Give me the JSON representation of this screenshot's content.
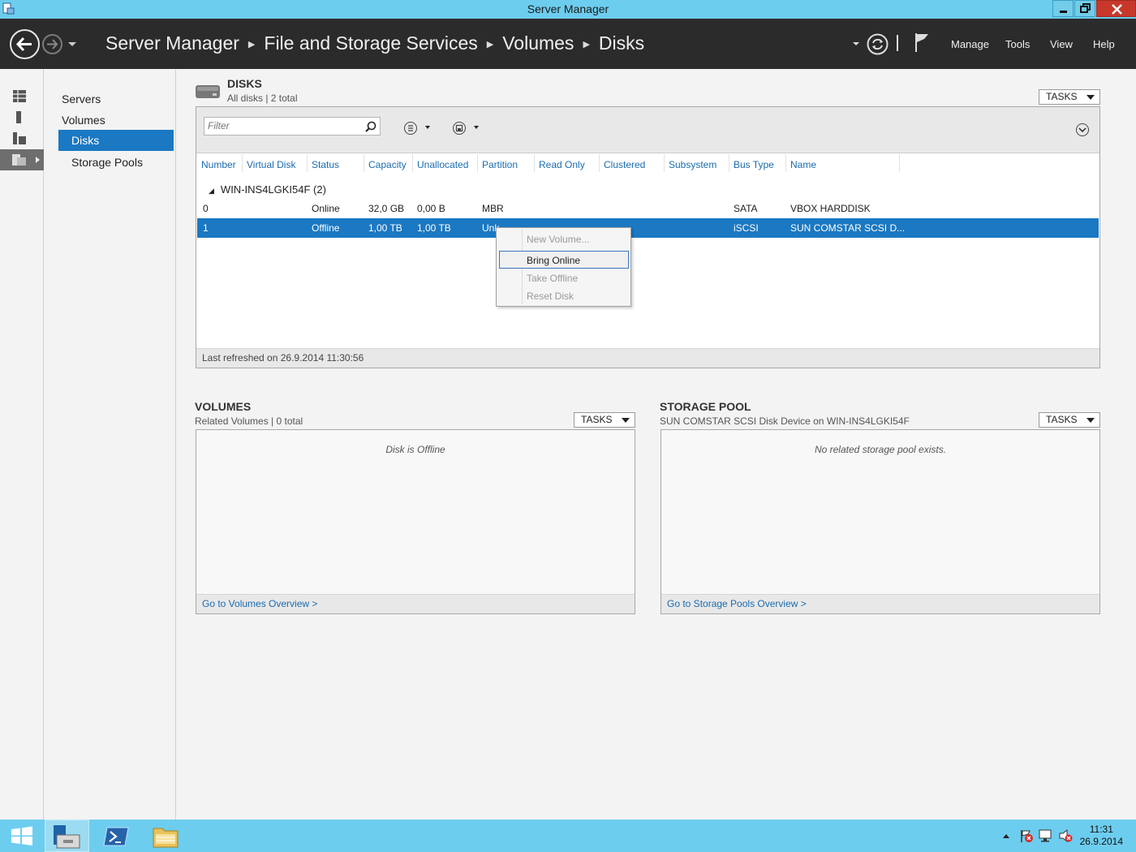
{
  "window": {
    "title": "Server Manager"
  },
  "header": {
    "breadcrumb": [
      "Server Manager",
      "File and Storage Services",
      "Volumes",
      "Disks"
    ],
    "menus": [
      "Manage",
      "Tools",
      "View",
      "Help"
    ]
  },
  "nav": {
    "items": [
      "Servers",
      "Volumes",
      "Disks",
      "Storage Pools"
    ]
  },
  "disks": {
    "title": "DISKS",
    "subtitle": "All disks | 2 total",
    "tasks_label": "TASKS",
    "filter_placeholder": "Filter",
    "columns": [
      "Number",
      "Virtual Disk",
      "Status",
      "Capacity",
      "Unallocated",
      "Partition",
      "Read Only",
      "Clustered",
      "Subsystem",
      "Bus Type",
      "Name"
    ],
    "group": "WIN-INS4LGKI54F (2)",
    "rows": [
      {
        "number": "0",
        "status": "Online",
        "capacity": "32,0 GB",
        "unallocated": "0,00 B",
        "partition": "MBR",
        "bus_type": "SATA",
        "name": "VBOX HARDDISK"
      },
      {
        "number": "1",
        "status": "Offline",
        "capacity": "1,00 TB",
        "unallocated": "1,00 TB",
        "partition": "Unk",
        "bus_type": "iSCSI",
        "name": "SUN COMSTAR SCSI D..."
      }
    ],
    "last_refreshed": "Last refreshed on 26.9.2014 11:30:56"
  },
  "context_menu": {
    "items": [
      "New Volume...",
      "Bring Online",
      "Take Offline",
      "Reset Disk"
    ]
  },
  "volumes": {
    "title": "VOLUMES",
    "subtitle": "Related Volumes | 0 total",
    "tasks_label": "TASKS",
    "message": "Disk is Offline",
    "link": "Go to Volumes Overview >"
  },
  "storage_pool": {
    "title": "STORAGE POOL",
    "subtitle": "SUN COMSTAR SCSI Disk Device on WIN-INS4LGKI54F",
    "tasks_label": "TASKS",
    "message": "No related storage pool exists.",
    "link": "Go to Storage Pools Overview >"
  },
  "taskbar": {
    "time": "11:31",
    "date": "26.9.2014"
  },
  "colors": {
    "accent": "#1b78c2",
    "titlebar": "#6dcdee",
    "header": "#2b2b2b",
    "close": "#c7382b"
  }
}
